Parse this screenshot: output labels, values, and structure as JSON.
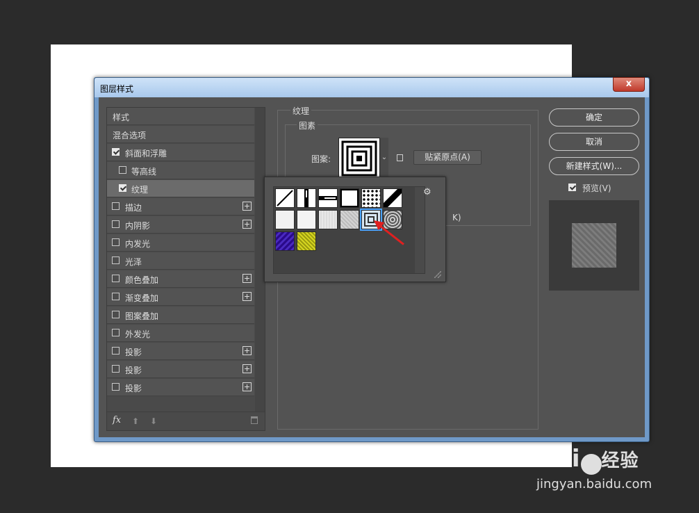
{
  "window": {
    "title": "图层样式",
    "close": "x"
  },
  "styles": {
    "header": "样式",
    "blend": "混合选项",
    "items": [
      {
        "label": "斜面和浮雕",
        "checked": true,
        "plus": false
      },
      {
        "label": "等高线",
        "checked": false,
        "plus": false
      },
      {
        "label": "纹理",
        "checked": true,
        "plus": false
      },
      {
        "label": "描边",
        "checked": false,
        "plus": true
      },
      {
        "label": "内阴影",
        "checked": false,
        "plus": true
      },
      {
        "label": "内发光",
        "checked": false,
        "plus": false
      },
      {
        "label": "光泽",
        "checked": false,
        "plus": false
      },
      {
        "label": "颜色叠加",
        "checked": false,
        "plus": true
      },
      {
        "label": "渐变叠加",
        "checked": false,
        "plus": true
      },
      {
        "label": "图案叠加",
        "checked": false,
        "plus": false
      },
      {
        "label": "外发光",
        "checked": false,
        "plus": false
      },
      {
        "label": "投影",
        "checked": false,
        "plus": true
      },
      {
        "label": "投影",
        "checked": false,
        "plus": true
      },
      {
        "label": "投影",
        "checked": false,
        "plus": true
      }
    ],
    "fx": "fx"
  },
  "texture": {
    "group_title": "纹理",
    "sub_title": "图素",
    "pattern_label": "图案:",
    "snap_button": "贴紧原点(A)",
    "hidden_suffix": "K)"
  },
  "buttons": {
    "ok": "确定",
    "cancel": "取消",
    "new_style": "新建样式(W)...",
    "preview": "预览(V)"
  },
  "watermark": {
    "brand": "Bai",
    "brand_suffix": "经验",
    "url": "jingyan.baidu.com"
  }
}
